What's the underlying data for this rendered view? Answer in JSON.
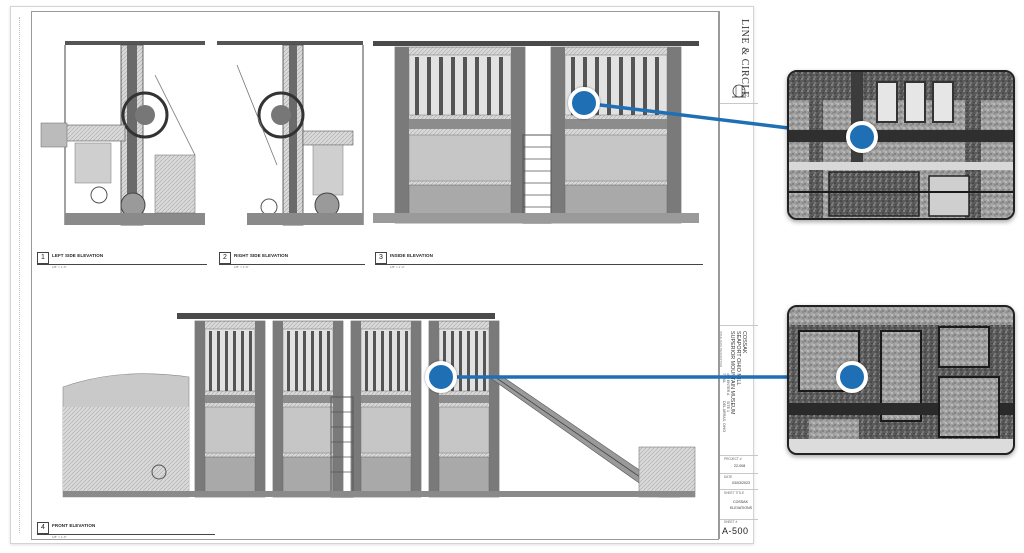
{
  "titleblock": {
    "firm": "LINE & CIRCLE",
    "project_lines": [
      "COSSAK",
      "SEAPORT OHIO MILL",
      "SUPERIOR MOUNTAIN MUSEUM"
    ],
    "address_lines": [
      "400 ENTER A",
      "TRAIL",
      "SITE 1",
      "DEL ARRAS, OHIO"
    ],
    "revisions_header": "ISSUE   DATE   DESCRIPTION",
    "project_no_label": "PROJECT #",
    "project_no": "22-008",
    "date_label": "DATE",
    "date": "03/03/2023",
    "sheet_title_label": "SHEET TITLE",
    "sheet_title": [
      "COSSAK",
      "ELEVATIONS"
    ],
    "sheet_no_label": "SHEET #",
    "sheet_no": "A-500"
  },
  "views": [
    {
      "num": "1",
      "title": "LEFT SIDE ELEVATION",
      "scale": "1/8\" = 1'-0\""
    },
    {
      "num": "2",
      "title": "RIGHT SIDE ELEVATION",
      "scale": "1/8\" = 1'-0\""
    },
    {
      "num": "3",
      "title": "INSIDE ELEVATION",
      "scale": "1/8\" = 1'-0\""
    },
    {
      "num": "4",
      "title": "FRONT ELEVATION",
      "scale": "1/8\" = 1'-0\""
    }
  ],
  "colors": {
    "accent": "#1f6fb5",
    "ink": "#222222"
  },
  "callouts": [
    {
      "name": "upper-detail",
      "target": "view-3"
    },
    {
      "name": "lower-detail",
      "target": "view-4"
    }
  ]
}
